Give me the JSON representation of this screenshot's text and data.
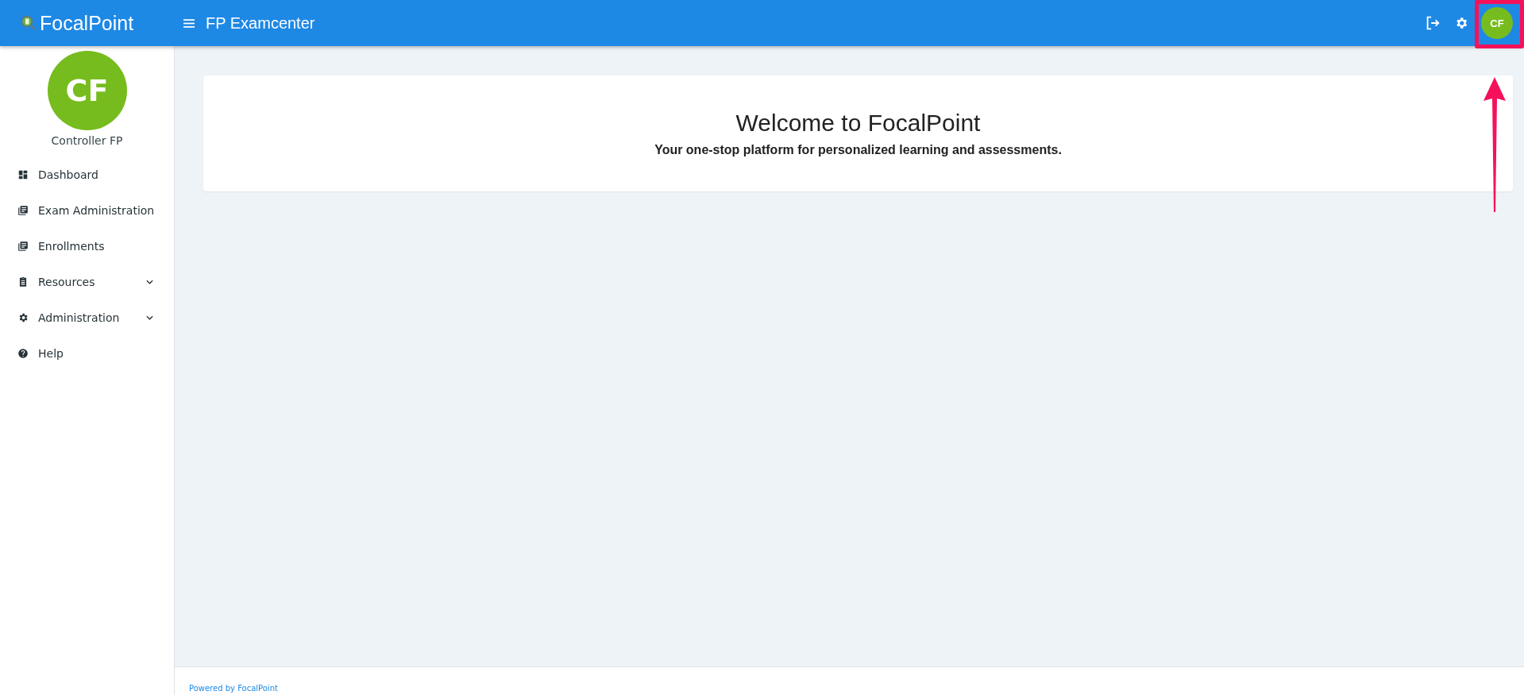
{
  "header": {
    "brand": "FocalPoint",
    "app_title": "FP Examcenter",
    "avatar": {
      "initials": "CF",
      "color": "#77bc1f"
    }
  },
  "sidebar": {
    "profile": {
      "initials": "CF",
      "name": "Controller FP",
      "color": "#77bc1f"
    },
    "items": [
      {
        "label": "Dashboard",
        "kind": "dashboard",
        "expandable": false
      },
      {
        "label": "Exam Administration",
        "kind": "library",
        "expandable": false
      },
      {
        "label": "Enrollments",
        "kind": "library",
        "expandable": false
      },
      {
        "label": "Resources",
        "kind": "clipboard",
        "expandable": true
      },
      {
        "label": "Administration",
        "kind": "gear",
        "expandable": true
      },
      {
        "label": "Help",
        "kind": "help",
        "expandable": false
      }
    ]
  },
  "welcome": {
    "title": "Welcome to FocalPoint",
    "subtitle": "Your one-stop platform for personalized learning and assessments."
  },
  "footer": {
    "text": "Powered by FocalPoint"
  },
  "annotation": {
    "highlight_box": true,
    "arrow": true
  }
}
